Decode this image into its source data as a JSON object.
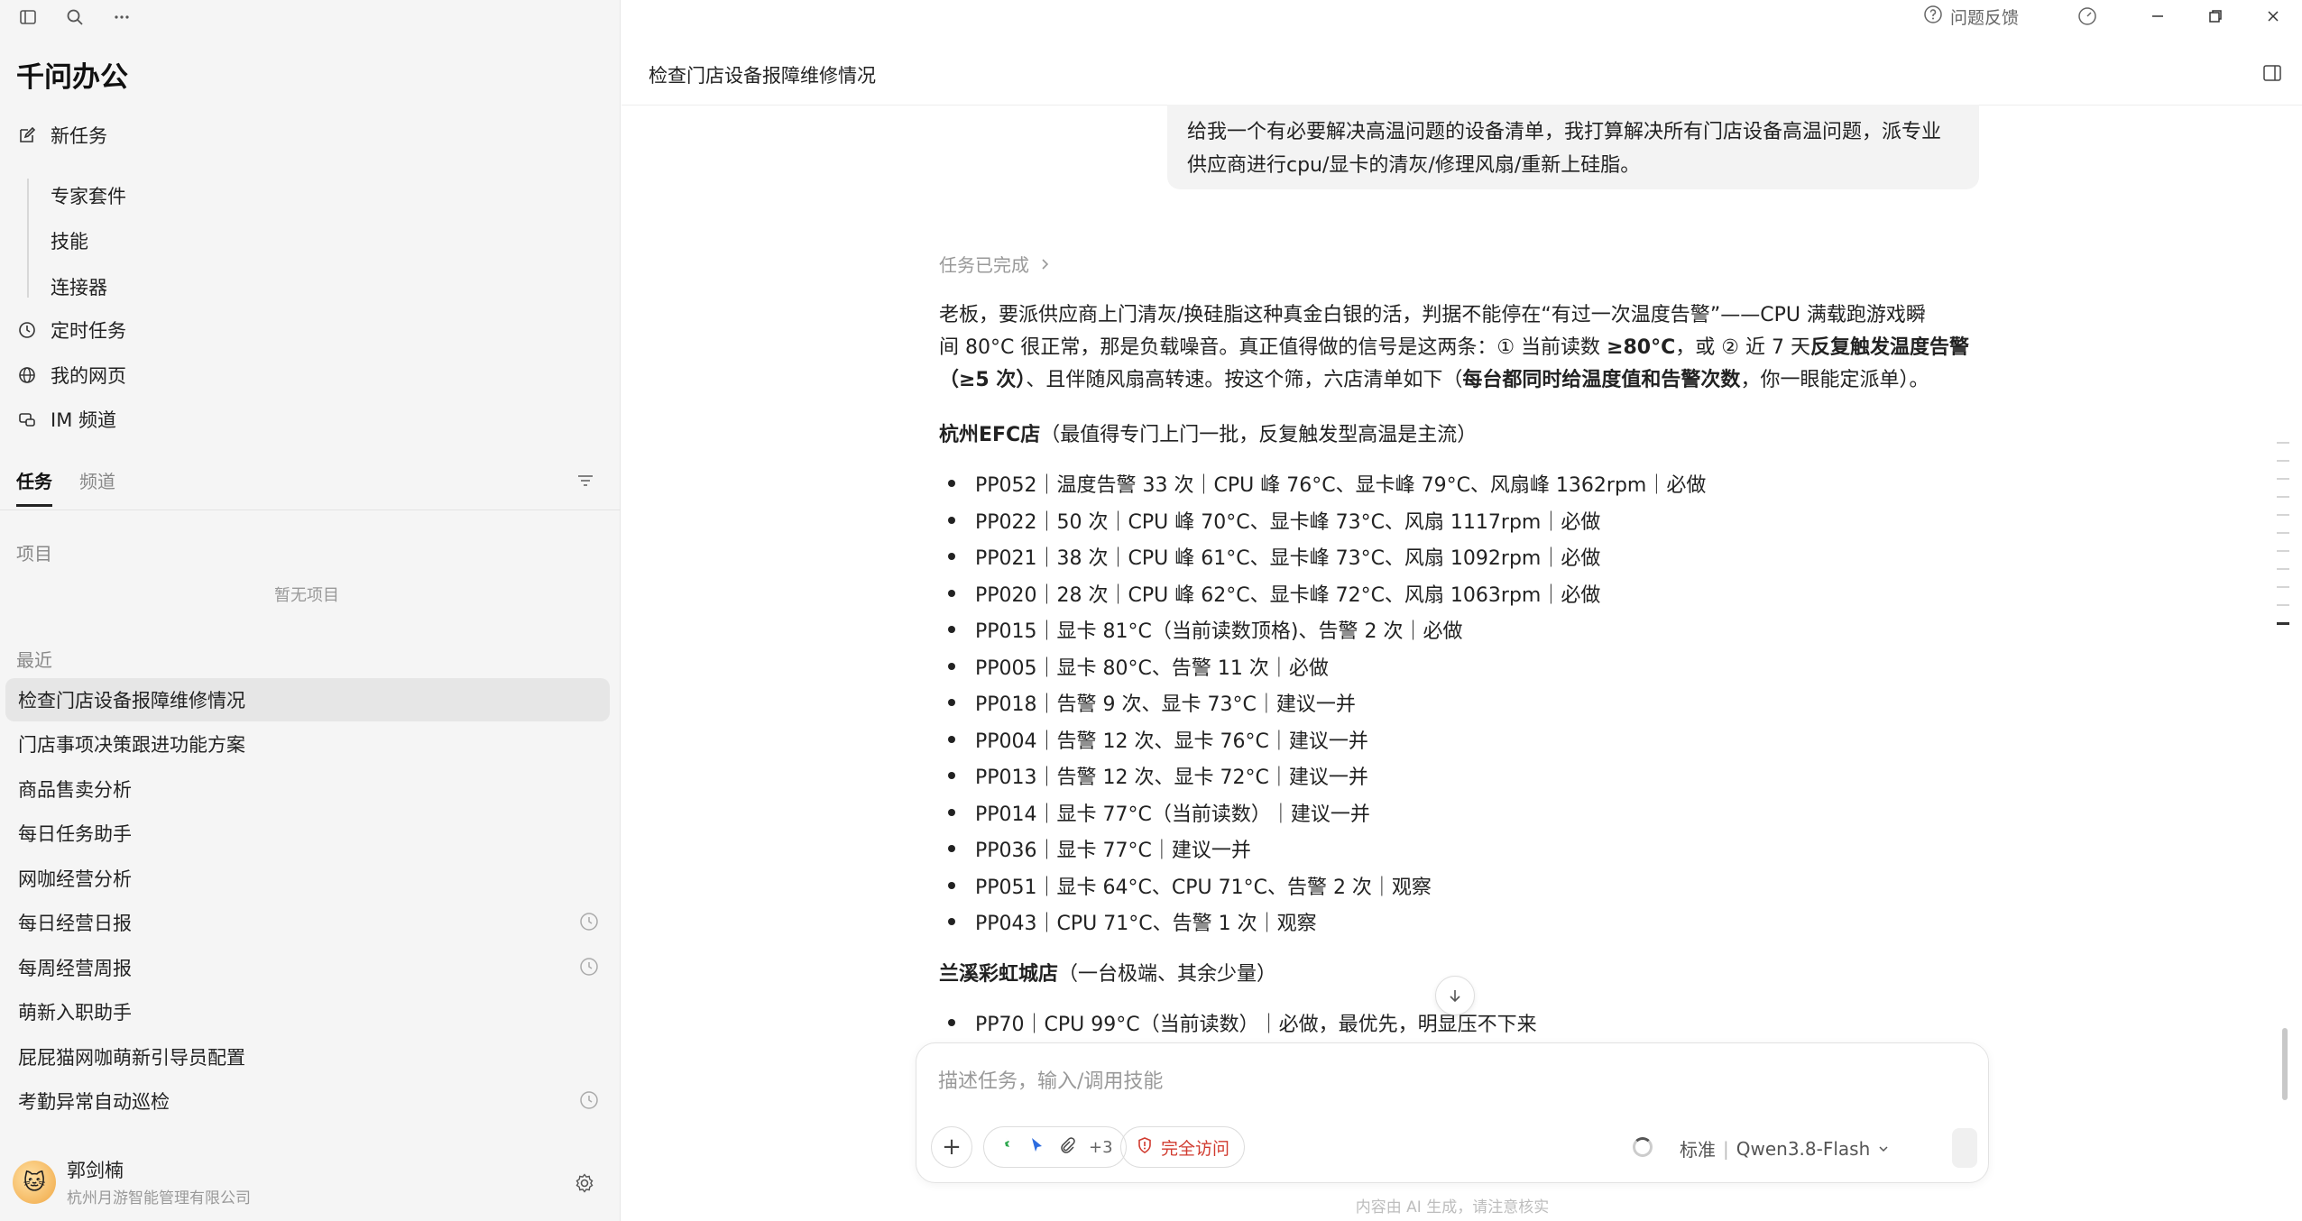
{
  "app": {
    "brand": "千问办公"
  },
  "sidebar": {
    "nav": {
      "new_task": "新任务",
      "sub": [
        "专家套件",
        "技能",
        "连接器"
      ],
      "scheduled": "定时任务",
      "webpages": "我的网页",
      "im": "IM 频道"
    },
    "tabs": [
      "任务",
      "频道"
    ],
    "projects_label": "项目",
    "projects_empty": "暂无项目",
    "recent_label": "最近",
    "recent": [
      {
        "label": "检查门店设备报障维修情况",
        "scheduled": false
      },
      {
        "label": "门店事项决策跟进功能方案",
        "scheduled": false
      },
      {
        "label": "商品售卖分析",
        "scheduled": false
      },
      {
        "label": "每日任务助手",
        "scheduled": false
      },
      {
        "label": "网咖经营分析",
        "scheduled": false
      },
      {
        "label": "每日经营日报",
        "scheduled": true
      },
      {
        "label": "每周经营周报",
        "scheduled": true
      },
      {
        "label": "萌新入职助手",
        "scheduled": false
      },
      {
        "label": "屁屁猫网咖萌新引导员配置",
        "scheduled": false
      },
      {
        "label": "考勤异常自动巡检",
        "scheduled": true
      }
    ],
    "user": {
      "name": "郭剑楠",
      "org": "杭州月游智能管理有限公司"
    }
  },
  "window": {
    "feedback": "问题反馈"
  },
  "main": {
    "title": "检查门店设备报障维修情况",
    "user_message_line1": "给我一个有必要解决高温问题的设备清单，我打算解决所有门店设备高温问题，派专业",
    "user_message_line2": "供应商进行cpu/显卡的清灰/修理风扇/重新上硅脂。",
    "status": "任务已完成",
    "intro": {
      "p1": "老板，要派供应商上门清灰/换硅脂这种真金白银的活，判据不能停在“有过一次温度告警”——CPU 满载跑游戏瞬",
      "p2": "间 80°C 很正常，那是负载噪音。真正值得做的信号是这两条：① 当前读数 ",
      "p2b": "≥80°C",
      "p2c": "，或 ② 近 7 天",
      "p2d": "反复触发温度告警",
      "p3a": "（≥5 次）",
      "p3b": "、且伴随风扇高转速。按这个筛，六店清单如下（",
      "p3c": "每台都同时给温度值和告警次数",
      "p3d": "，你一眼能定派单）。"
    },
    "stores": [
      {
        "name": "杭州EFC店",
        "note": "（最值得专门上门一批，反复触发型高温是主流）",
        "items": [
          "PP052｜温度告警 33 次｜CPU 峰 76°C、显卡峰 79°C、风扇峰 1362rpm｜必做",
          "PP022｜50 次｜CPU 峰 70°C、显卡峰 73°C、风扇 1117rpm｜必做",
          "PP021｜38 次｜CPU 峰 61°C、显卡峰 73°C、风扇 1092rpm｜必做",
          "PP020｜28 次｜CPU 峰 62°C、显卡峰 72°C、风扇 1063rpm｜必做",
          "PP015｜显卡 81°C（当前读数顶格)、告警 2 次｜必做",
          "PP005｜显卡 80°C、告警 11 次｜必做",
          "PP018｜告警 9 次、显卡 73°C｜建议一并",
          "PP004｜告警 12 次、显卡 76°C｜建议一并",
          "PP013｜告警 12 次、显卡 72°C｜建议一并",
          "PP014｜显卡 77°C（当前读数）｜建议一并",
          "PP036｜显卡 77°C｜建议一并",
          "PP051｜显卡 64°C、CPU 71°C、告警 2 次｜观察",
          "PP043｜CPU 71°C、告警 1 次｜观察"
        ]
      },
      {
        "name": "兰溪彩虹城店",
        "note": "（一台极端、其余少量）",
        "items": [
          "PP70｜CPU 99°C（当前读数）｜必做，最优先，明显压不下来"
        ]
      }
    ]
  },
  "composer": {
    "placeholder": "描述任务，输入/调用技能",
    "tools_more": "+3",
    "access": "完全访问",
    "mode": "标准",
    "model": "Qwen3.8-Flash",
    "disclaimer": "内容由 AI 生成，请注意核实"
  },
  "colors": {
    "accent_red": "#d13b2f",
    "sidebar_bg": "#f5f5f5"
  }
}
